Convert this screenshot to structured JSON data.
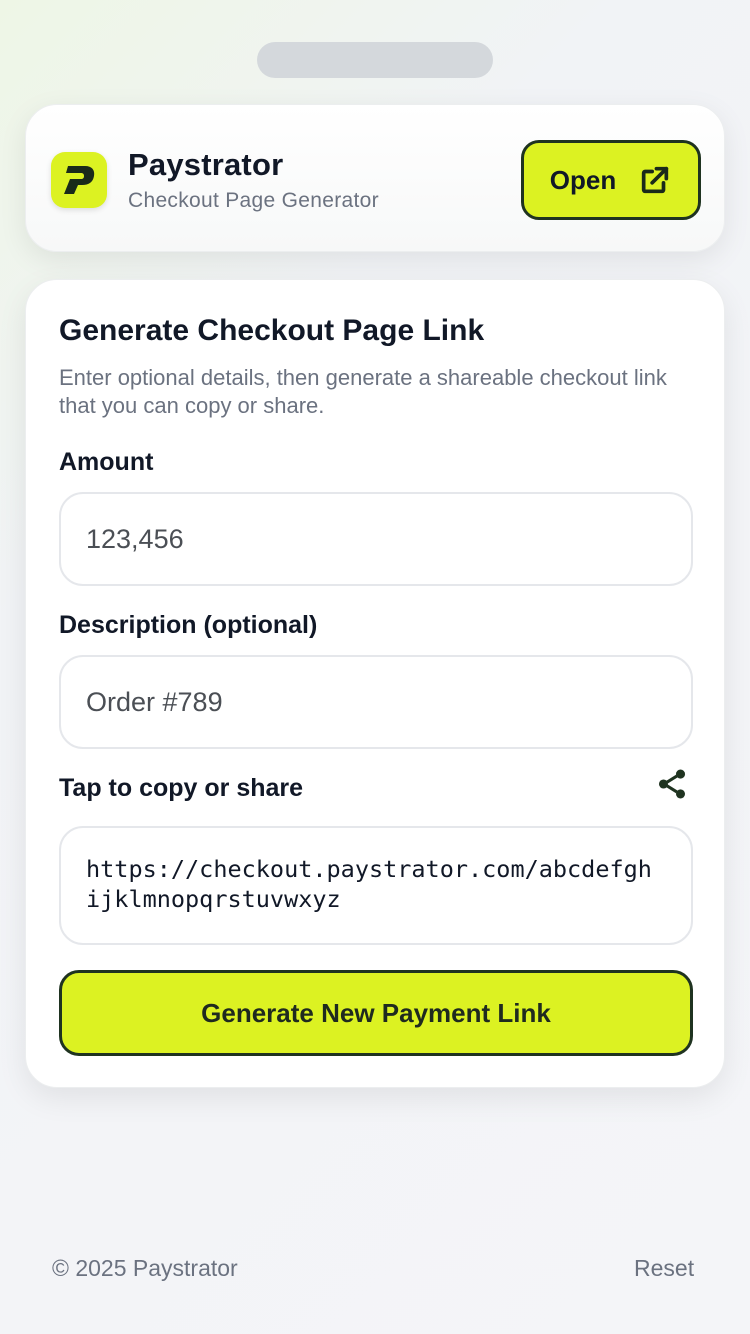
{
  "app": {
    "name": "Paystrator",
    "subtitle": "Checkout Page Generator",
    "open_label": "Open",
    "logo_icon": "paystrator-logo-icon",
    "open_icon": "external-link-icon"
  },
  "form": {
    "title": "Generate Checkout Page Link",
    "description": "Enter optional details, then generate a shareable checkout link that you can copy or share.",
    "amount_label": "Amount",
    "amount_value": "123,456",
    "description_label": "Description (optional)",
    "description_value": "Order #789",
    "share_label": "Tap to copy or share",
    "share_icon": "share-icon",
    "link": "https://checkout.paystrator.com/abcdefghijklmnopqrstuvwxyz",
    "generate_label": "Generate New Payment Link"
  },
  "footer": {
    "copyright": "© 2025 Paystrator",
    "reset_label": "Reset"
  },
  "colors": {
    "accent": "#dcf222",
    "dark": "#1f3320",
    "text": "#111827",
    "muted": "#6b7280"
  }
}
